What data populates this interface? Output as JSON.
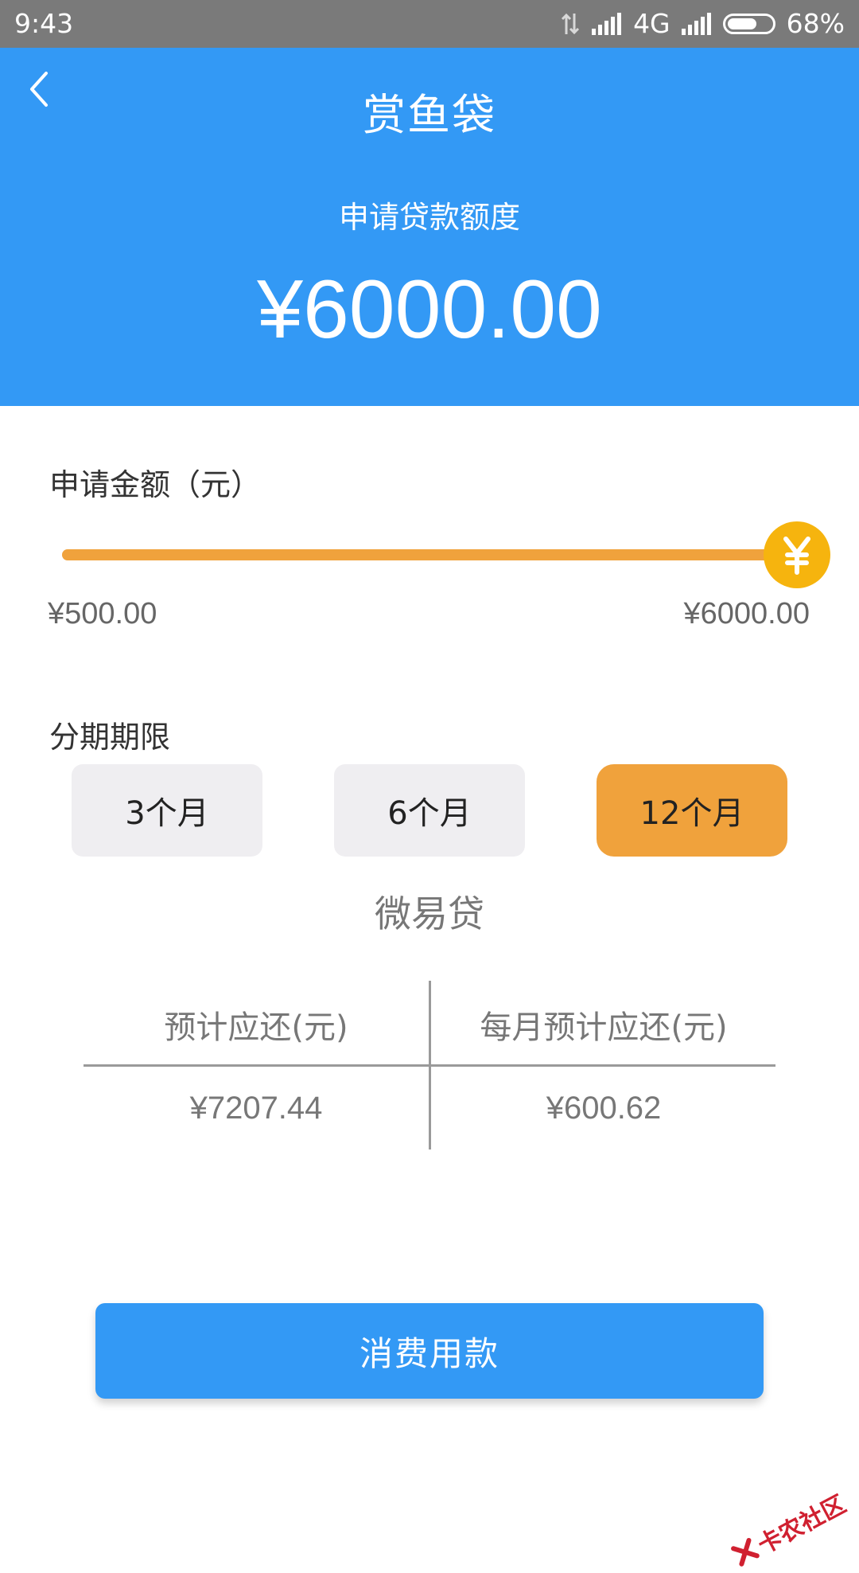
{
  "status_bar": {
    "time": "9:43",
    "network": "4G",
    "battery": "68%",
    "battery_level": 0.68
  },
  "header": {
    "title": "赏鱼袋",
    "quota_label": "申请贷款额度",
    "quota_amount": "¥6000.00"
  },
  "amount": {
    "label": "申请金额（元）",
    "min_label": "¥500.00",
    "max_label": "¥6000.00",
    "min": 500,
    "max": 6000,
    "value": 6000,
    "knob_icon": "yuan-icon"
  },
  "term": {
    "label": "分期期限",
    "options": [
      "3个月",
      "6个月",
      "12个月"
    ],
    "selected_index": 2
  },
  "product_name": "微易贷",
  "summary": {
    "headers": [
      "预计应还(元)",
      "每月预计应还(元)"
    ],
    "values": [
      "¥7207.44",
      "¥600.62"
    ]
  },
  "submit_label": "消费用款",
  "watermark": "卡农社区",
  "colors": {
    "primary": "#3399f5",
    "accent": "#f0a23c",
    "knob": "#f6b40e",
    "watermark": "#d02030"
  }
}
